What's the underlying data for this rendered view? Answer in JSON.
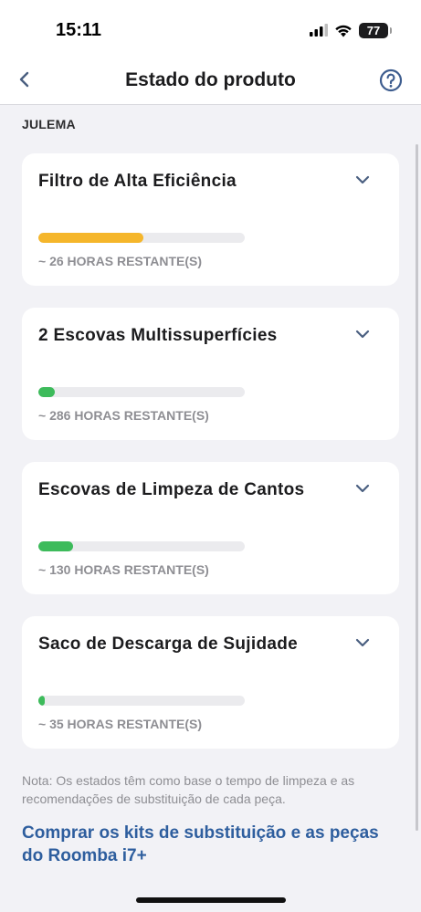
{
  "status_bar": {
    "time": "15:11",
    "battery": "77"
  },
  "nav": {
    "title": "Estado do produto"
  },
  "robot_name": "JULEMA",
  "parts": [
    {
      "name": "Filtro de Alta Eficiência",
      "remaining": "~ 26 HORAS RESTANTE(S)",
      "level": 0.51,
      "color": "#f5b62b"
    },
    {
      "name": "2 Escovas Multissuperfícies",
      "remaining": "~ 286 HORAS RESTANTE(S)",
      "level": 0.08,
      "color": "#3dbb5b"
    },
    {
      "name": "Escovas de Limpeza de Cantos",
      "remaining": "~ 130 HORAS RESTANTE(S)",
      "level": 0.17,
      "color": "#3dbb5b"
    },
    {
      "name": "Saco de Descarga de Sujidade",
      "remaining": "~ 35 HORAS RESTANTE(S)",
      "level": 0.03,
      "color": "#3dbb5b"
    }
  ],
  "note": "Nota: Os estados têm como base o tempo de limpeza e as recomendações de substituição de cada peça.",
  "link": "Comprar os kits de substituição e as peças do Roomba i7+"
}
